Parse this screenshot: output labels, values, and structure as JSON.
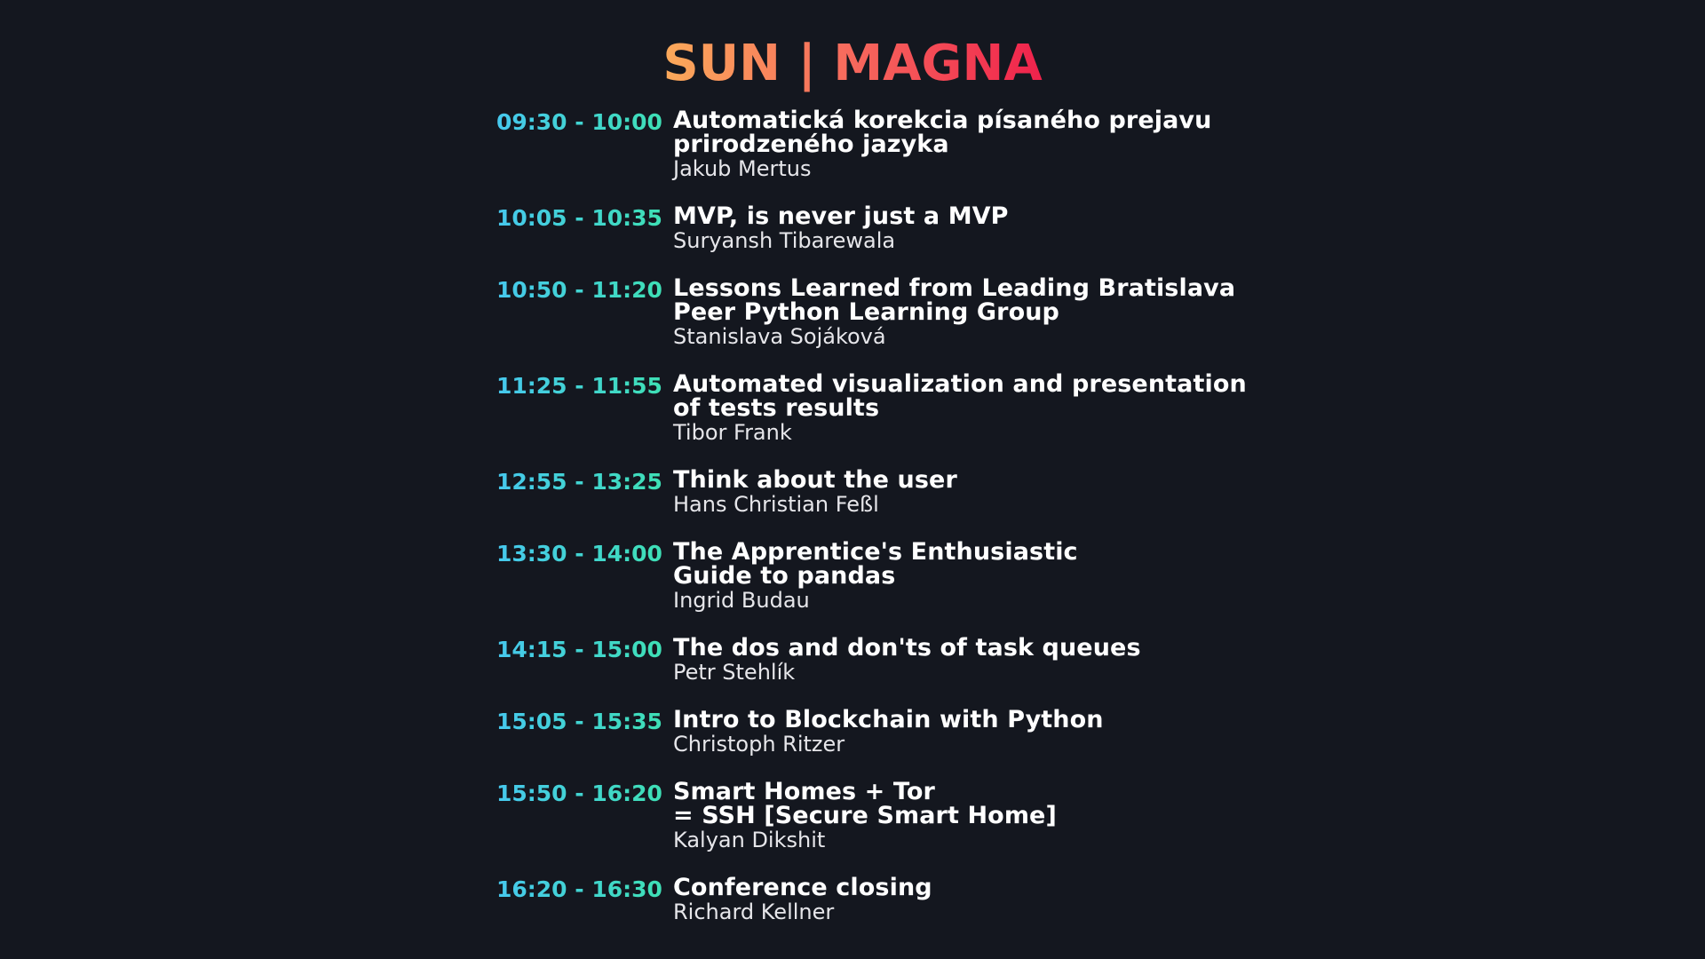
{
  "header": {
    "title": "SUN | MAGNA"
  },
  "colors": {
    "background": "#14171f",
    "title_gradient_start": "#fbaa5a",
    "title_gradient_end": "#f0224c",
    "time_gradient_start": "#46c8ee",
    "time_gradient_end": "#3ee0b4",
    "talk_title": "#ffffff",
    "speaker": "#e6e6ea"
  },
  "schedule": [
    {
      "time": "09:30 - 10:00",
      "title_lines": [
        "Automatická korekcia písaného prejavu",
        "prirodzeného jazyka"
      ],
      "speaker": "Jakub Mertus"
    },
    {
      "time": "10:05 - 10:35",
      "title_lines": [
        "MVP, is never just a MVP"
      ],
      "speaker": "Suryansh Tibarewala"
    },
    {
      "time": "10:50 - 11:20",
      "title_lines": [
        "Lessons Learned from Leading Bratislava",
        "Peer Python Learning Group"
      ],
      "speaker": "Stanislava Sojáková"
    },
    {
      "time": "11:25 - 11:55",
      "title_lines": [
        "Automated visualization and presentation",
        "of tests results"
      ],
      "speaker": "Tibor Frank"
    },
    {
      "time": "12:55 - 13:25",
      "title_lines": [
        "Think about the user"
      ],
      "speaker": "Hans Christian Feßl"
    },
    {
      "time": "13:30 - 14:00",
      "title_lines": [
        "The Apprentice's Enthusiastic",
        "Guide to pandas"
      ],
      "speaker": "Ingrid Budau"
    },
    {
      "time": "14:15 - 15:00",
      "title_lines": [
        "The dos and don'ts of task queues"
      ],
      "speaker": "Petr Stehlík"
    },
    {
      "time": "15:05 - 15:35",
      "title_lines": [
        "Intro to Blockchain with Python"
      ],
      "speaker": "Christoph Ritzer"
    },
    {
      "time": "15:50 - 16:20",
      "title_lines": [
        "Smart Homes + Tor",
        "= SSH [Secure Smart Home]"
      ],
      "speaker": "Kalyan Dikshit"
    },
    {
      "time": "16:20 - 16:30",
      "title_lines": [
        "Conference closing"
      ],
      "speaker": "Richard Kellner"
    }
  ]
}
